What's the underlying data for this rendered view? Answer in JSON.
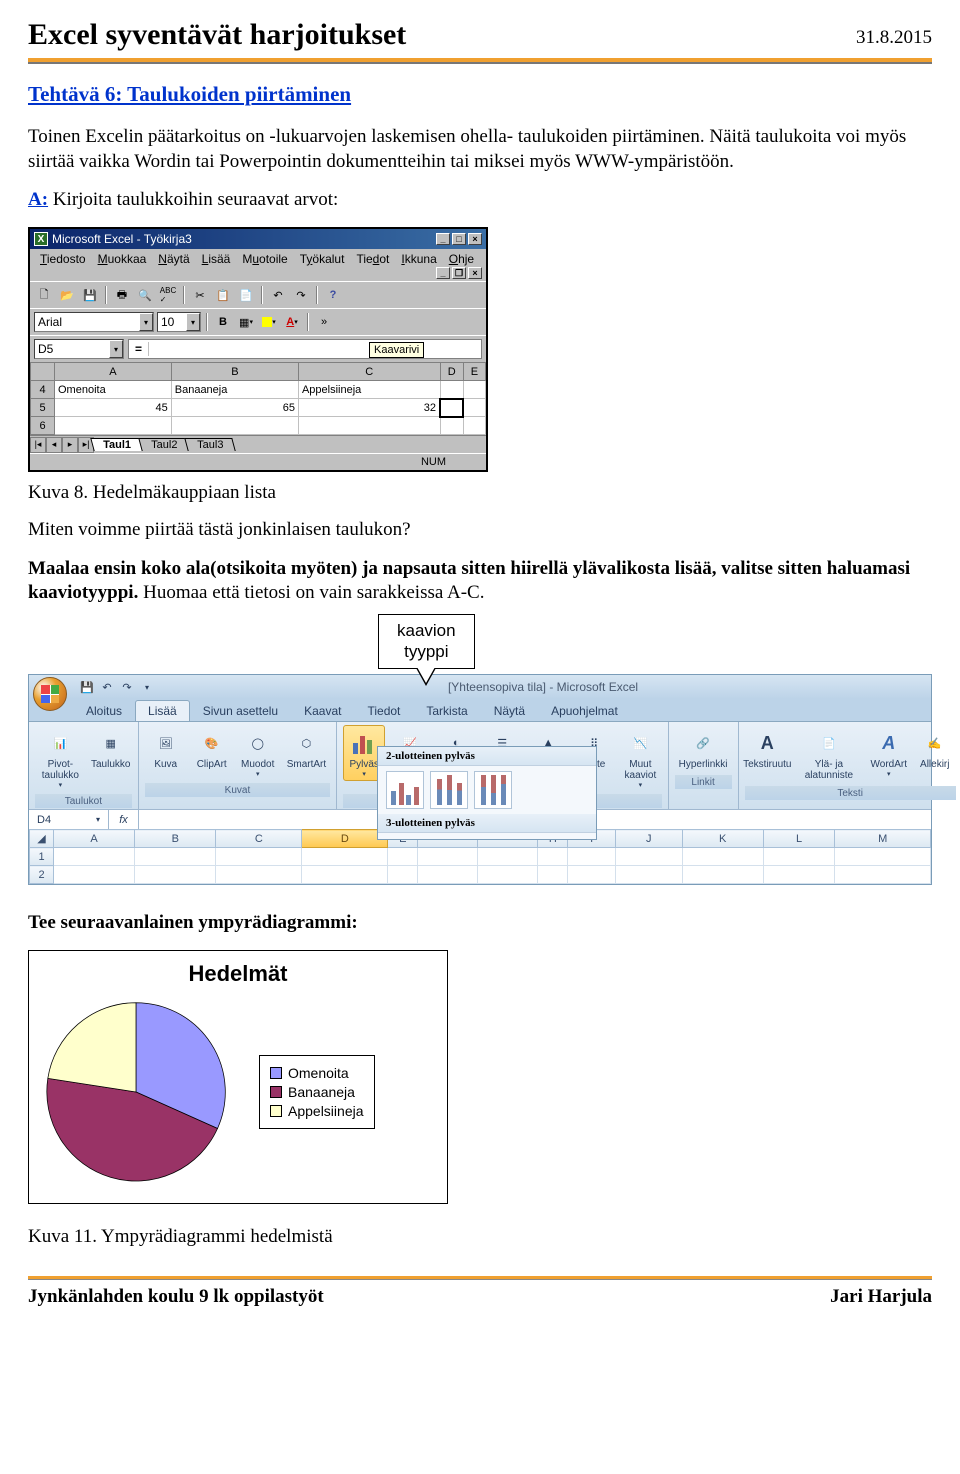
{
  "header": {
    "title": "Excel syventävät harjoitukset",
    "date": "31.8.2015"
  },
  "task": {
    "title": "Tehtävä 6: Taulukoiden piirtäminen"
  },
  "intro": {
    "p1": "Toinen Excelin päätarkoitus on -lukuarvojen laskemisen ohella- taulukoiden piirtäminen. Näitä taulukoita voi myös siirtää vaikka Wordin tai Powerpointin dokumentteihin tai miksei myös WWW-ympäristöön.",
    "a_label": "A:",
    "a_text": " Kirjoita taulukkoihin seuraavat arvot:"
  },
  "excel97": {
    "title": "Microsoft Excel - Työkirja3",
    "menu": [
      "Tiedosto",
      "Muokkaa",
      "Näytä",
      "Lisää",
      "Muotoile",
      "Työkalut",
      "Tiedot",
      "Ikkuna",
      "Ohje"
    ],
    "font": "Arial",
    "fontsize": "10",
    "cellref": "D5",
    "tooltip": "Kaavarivi",
    "cols": [
      "A",
      "B",
      "C",
      "D",
      "E"
    ],
    "rows": [
      {
        "n": "4",
        "cells": [
          "Omenoita",
          "Banaaneja",
          "Appelsiineja",
          "",
          ""
        ]
      },
      {
        "n": "5",
        "cells": [
          "45",
          "65",
          "32",
          "",
          ""
        ]
      },
      {
        "n": "6",
        "cells": [
          "",
          "",
          "",
          "",
          ""
        ]
      }
    ],
    "tabs": [
      "Taul1",
      "Taul2",
      "Taul3"
    ],
    "status": "NUM"
  },
  "caption8": "Kuva 8. Hedelmäkauppiaan lista",
  "body2": {
    "q": "Miten voimme piirtää tästä jonkinlaisen taulukon?",
    "bold": "Maalaa ensin koko ala(otsikoita myöten) ja napsauta sitten hiirellä ylävalikosta lisää, valitse sitten haluamasi kaaviotyyppi.",
    "tail": " Huomaa että tietosi on vain sarakkeissa A-C."
  },
  "callout": {
    "l1": "kaavion",
    "l2": "tyyppi"
  },
  "ribbon": {
    "titlebar": "[Yhteensopiva tila] - Microsoft Excel",
    "tabs": [
      "Aloitus",
      "Lisää",
      "Sivun asettelu",
      "Kaavat",
      "Tiedot",
      "Tarkista",
      "Näytä",
      "Apuohjelmat"
    ],
    "active_tab": 1,
    "groups": {
      "taulukot": {
        "label": "Taulukot",
        "items": [
          "Pivot-taulukko",
          "Taulukko"
        ]
      },
      "kuvat": {
        "label": "Kuvat",
        "items": [
          "Kuva",
          "ClipArt",
          "Muodot",
          "SmartArt"
        ]
      },
      "kaaviot": {
        "label": "Kaaviot",
        "items": [
          "Pylväs",
          "Viiva",
          "Ympyrä",
          "Palkki",
          "Alue",
          "Piste",
          "Muut kaaviot"
        ]
      },
      "linkit": {
        "label": "Linkit",
        "items": [
          "Hyperlinkki"
        ]
      },
      "teksti": {
        "label": "Teksti",
        "items": [
          "Tekstiruutu",
          "Ylä- ja alatunniste",
          "WordArt",
          "Allekirj"
        ]
      }
    },
    "dropdown": {
      "h1": "2-ulotteinen pylväs",
      "h2": "3-ulotteinen pylväs"
    },
    "cellref": "D4",
    "fx": "fx",
    "cols": [
      "A",
      "B",
      "C",
      "D",
      "E",
      "F",
      "G",
      "H",
      "I",
      "J",
      "K",
      "L",
      "M"
    ],
    "rows": [
      "1",
      "2"
    ]
  },
  "task2": "Tee seuraavanlainen ympyrädiagrammi:",
  "chart_data": {
    "type": "pie",
    "title": "Hedelmät",
    "categories": [
      "Omenoita",
      "Banaaneja",
      "Appelsiineja"
    ],
    "values": [
      45,
      65,
      32
    ],
    "colors": [
      "#9999ff",
      "#993366",
      "#ffffcc"
    ]
  },
  "caption11": "Kuva 11. Ympyrädiagrammi hedelmistä",
  "footer": {
    "left": "Jynkänlahden koulu 9 lk oppilastyöt",
    "right": "Jari Harjula"
  }
}
